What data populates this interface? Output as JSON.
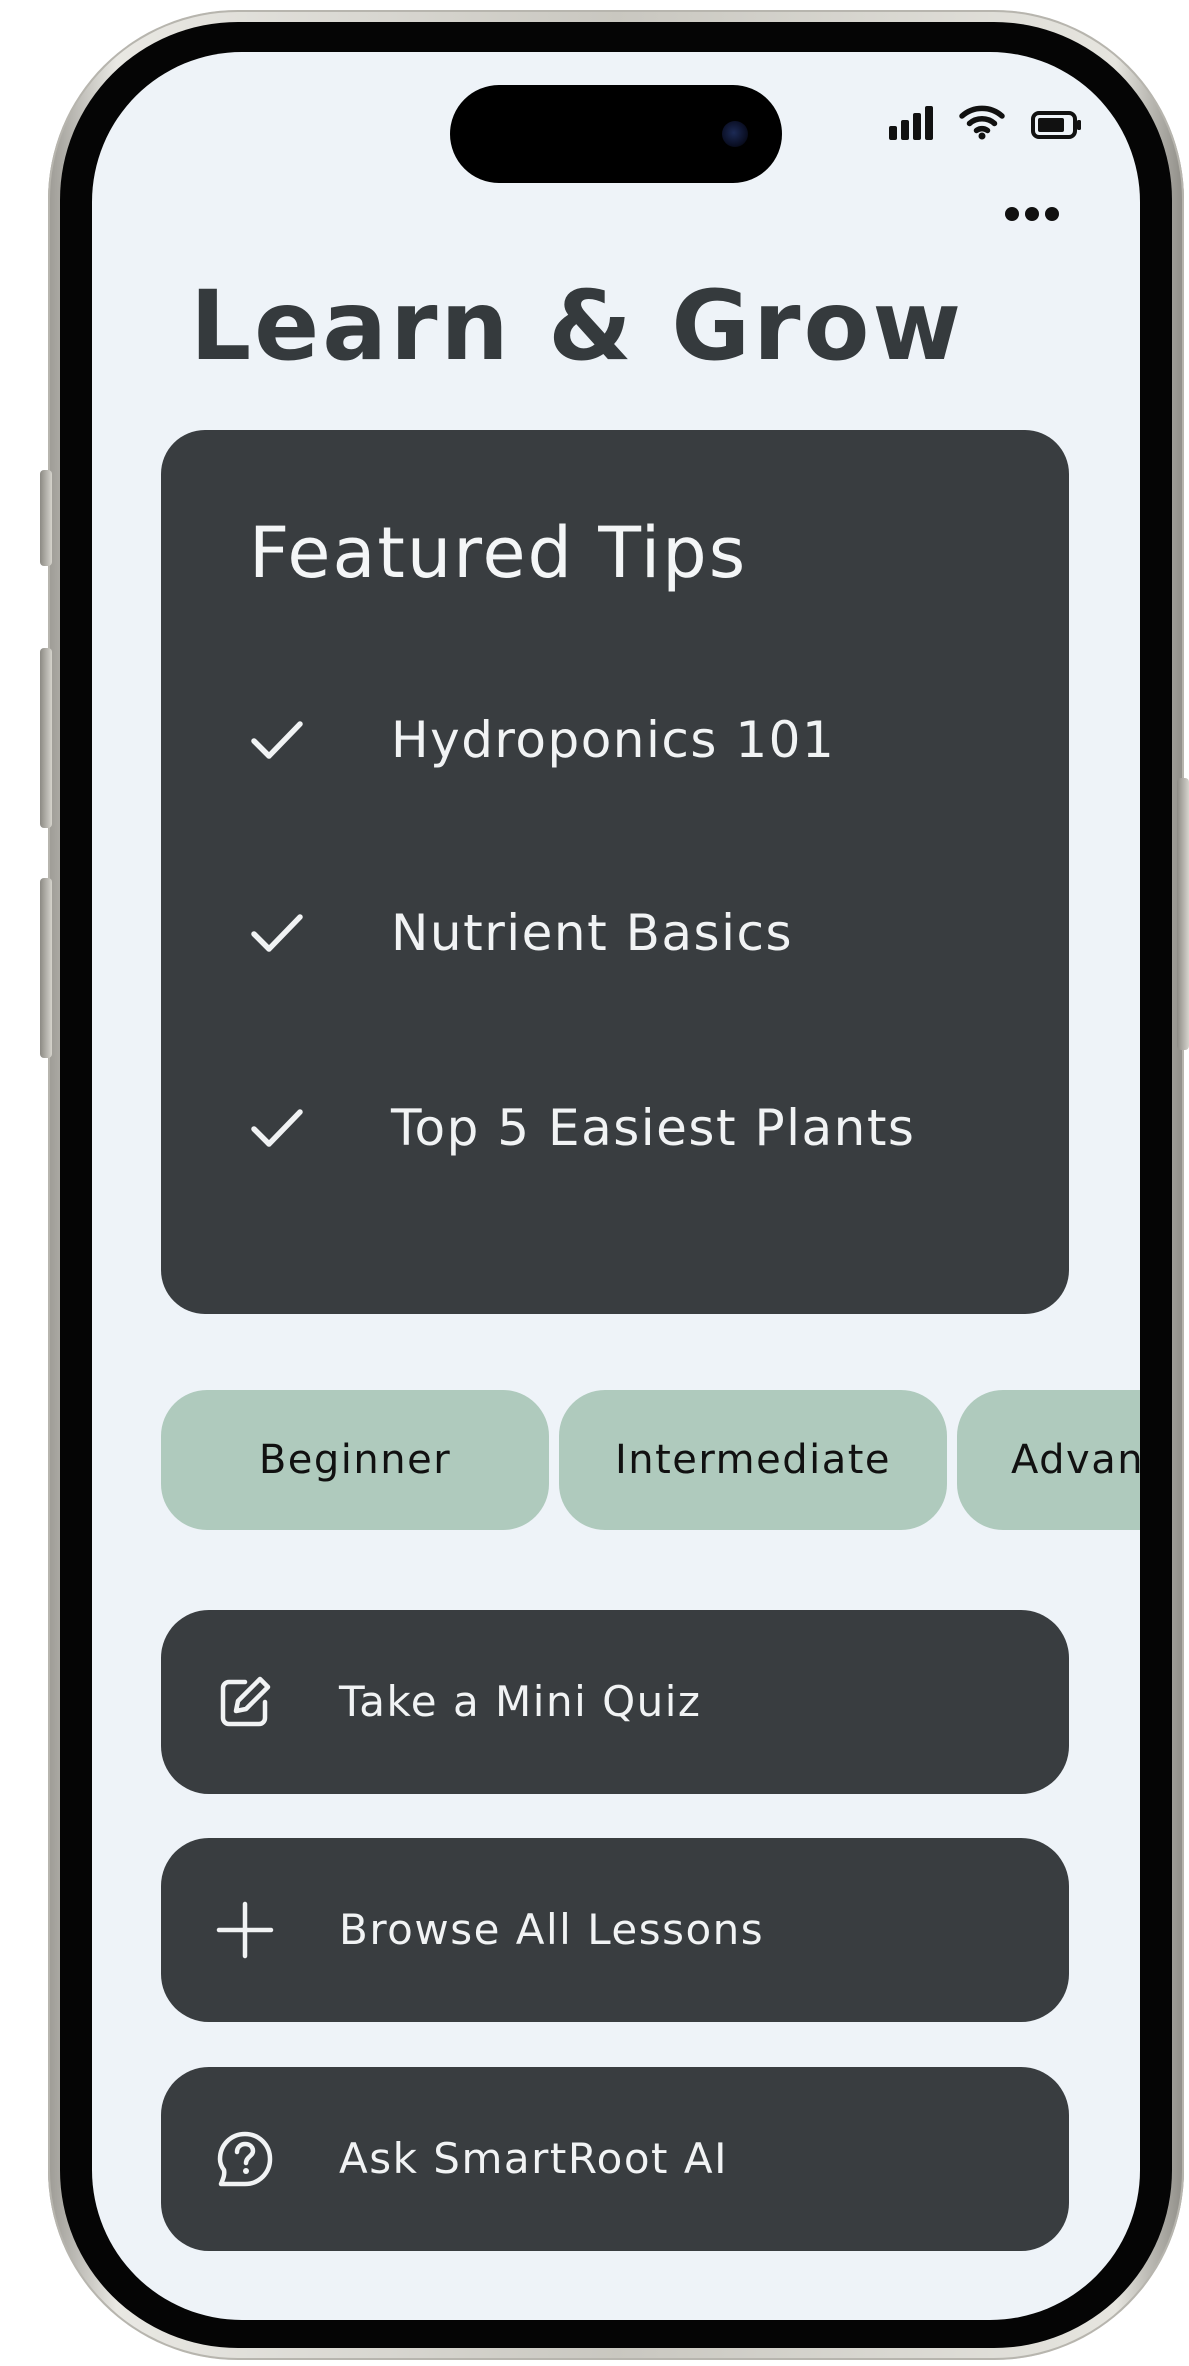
{
  "page": {
    "title": "Learn & Grow"
  },
  "featured": {
    "title": "Featured Tips",
    "items": [
      {
        "label": "Hydroponics 101",
        "icon": "check-icon"
      },
      {
        "label": "Nutrient Basics",
        "icon": "check-icon"
      },
      {
        "label": "Top 5 Easiest Plants",
        "icon": "check-icon"
      }
    ]
  },
  "levels": [
    {
      "label": "Beginner"
    },
    {
      "label": "Intermediate"
    },
    {
      "label": "Advanced"
    }
  ],
  "actions": [
    {
      "label": "Take a Mini Quiz",
      "icon": "edit-icon"
    },
    {
      "label": "Browse All Lessons",
      "icon": "plus-icon"
    },
    {
      "label": "Ask SmartRoot AI",
      "icon": "help-chat-icon"
    }
  ],
  "colors": {
    "background": "#eef3f8",
    "card": "#393d40",
    "chip": "#afcabd",
    "title": "#353a3d"
  }
}
